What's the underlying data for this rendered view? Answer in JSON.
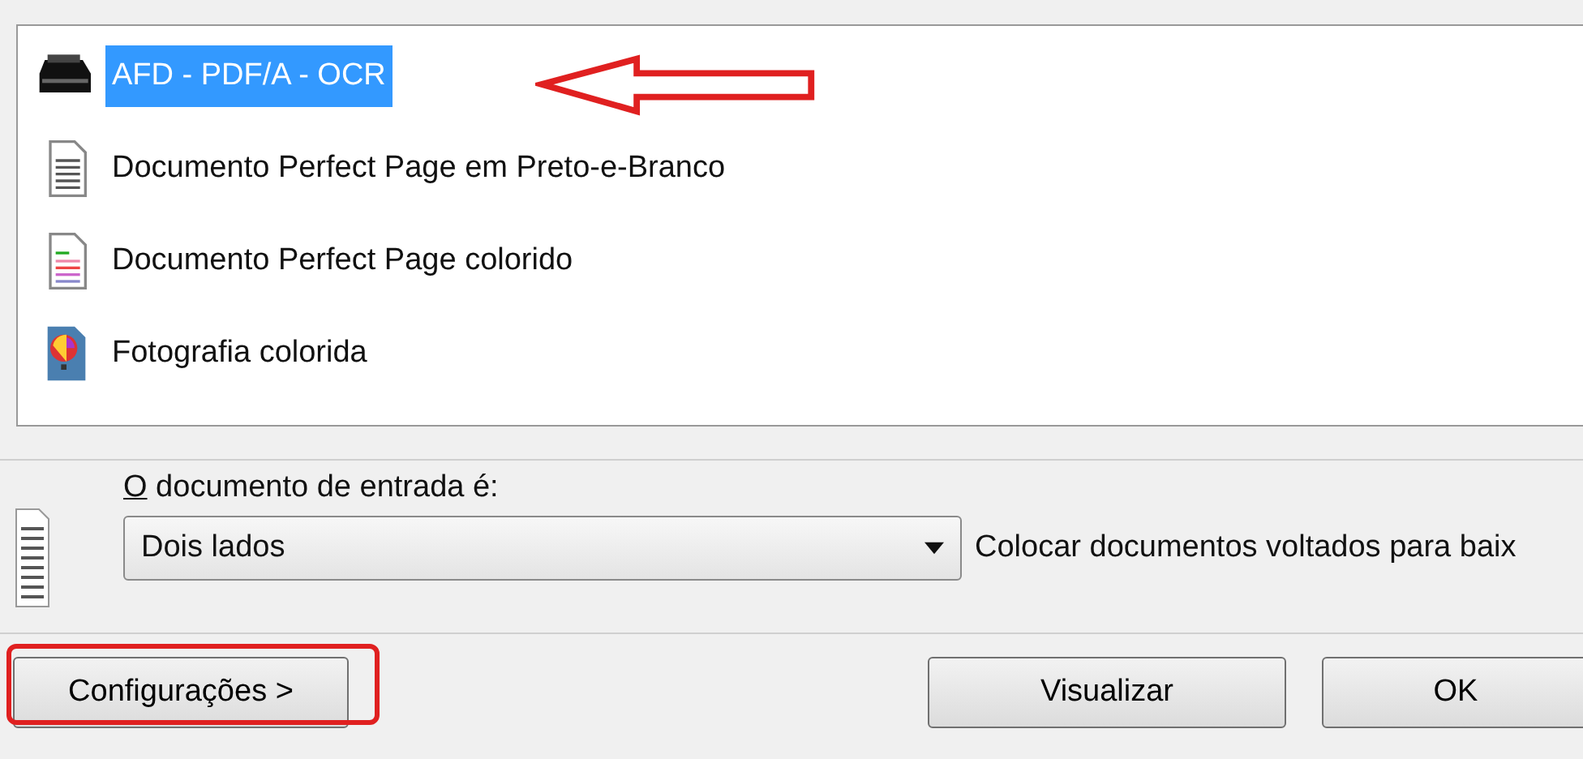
{
  "profiles": [
    {
      "label": "AFD - PDF/A - OCR",
      "kind": "scanner",
      "selected": true
    },
    {
      "label": "Documento Perfect Page em Preto-e-Branco",
      "kind": "bw-document",
      "selected": false
    },
    {
      "label": "Documento Perfect Page colorido",
      "kind": "color-document",
      "selected": false
    },
    {
      "label": "Fotografia colorida",
      "kind": "photo",
      "selected": false
    }
  ],
  "input_document": {
    "label": "O documento de entrada é:",
    "value": "Dois lados",
    "hint": "Colocar documentos voltados para baix"
  },
  "buttons": {
    "settings": "Configurações >",
    "preview": "Visualizar",
    "ok": "OK"
  }
}
